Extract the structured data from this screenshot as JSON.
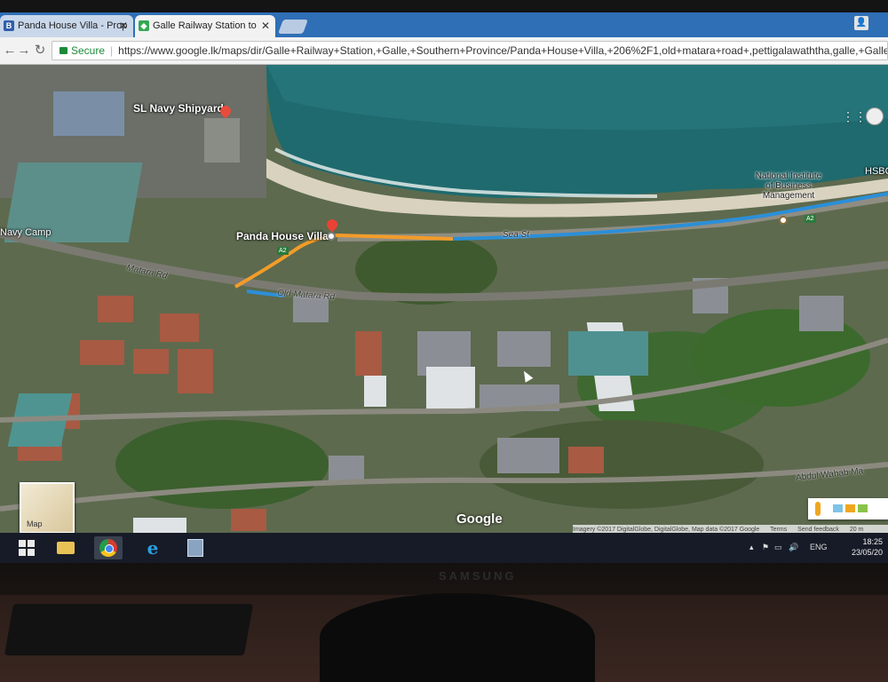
{
  "tabs": [
    {
      "label": "Panda House Villa - Prop",
      "favicon": "B",
      "favicon_color": "#2f5fa8"
    },
    {
      "label": "Galle Railway Station to",
      "favicon": "maps",
      "favicon_color": "#34a853"
    }
  ],
  "address_bar": {
    "secure_label": "Secure",
    "url": "https://www.google.lk/maps/dir/Galle+Railway+Station,+Galle,+Southern+Province/Panda+House+Villa,+206%2F1,old+matara+road+,pettigalawaththa,galle,+Galle+80000/@6."
  },
  "map": {
    "labels": {
      "navy_shipyard": "SL Navy Shipyard",
      "navy_camp": "Navy Camp",
      "destination": "Panda House Villa",
      "matara_rd": "Matara Rd",
      "old_matara_rd": "Old Matara Rd",
      "sea_st": "Sea St",
      "institute": "National Institute of Business Management",
      "hsbc": "HSBC",
      "abdul_wahab": "Abdul Wahab Ma",
      "highway_a2_left": "A2",
      "highway_a2_right": "A2"
    },
    "minimap_label": "Map",
    "google_logo": "Google",
    "attribution": {
      "imagery": "Imagery ©2017 DigitalGlobe, DigitalGlobe, Map data ©2017 Google",
      "terms": "Terms",
      "feedback": "Send feedback",
      "scale": "20 m"
    },
    "colors": {
      "route_main": "#2b8fd8",
      "route_alt": "#f39c29",
      "sea": "#1f6a6e"
    }
  },
  "taskbar": {
    "language": "ENG",
    "time": "18:25",
    "date": "23/05/20"
  },
  "monitor_brand": "SAMSUNG"
}
